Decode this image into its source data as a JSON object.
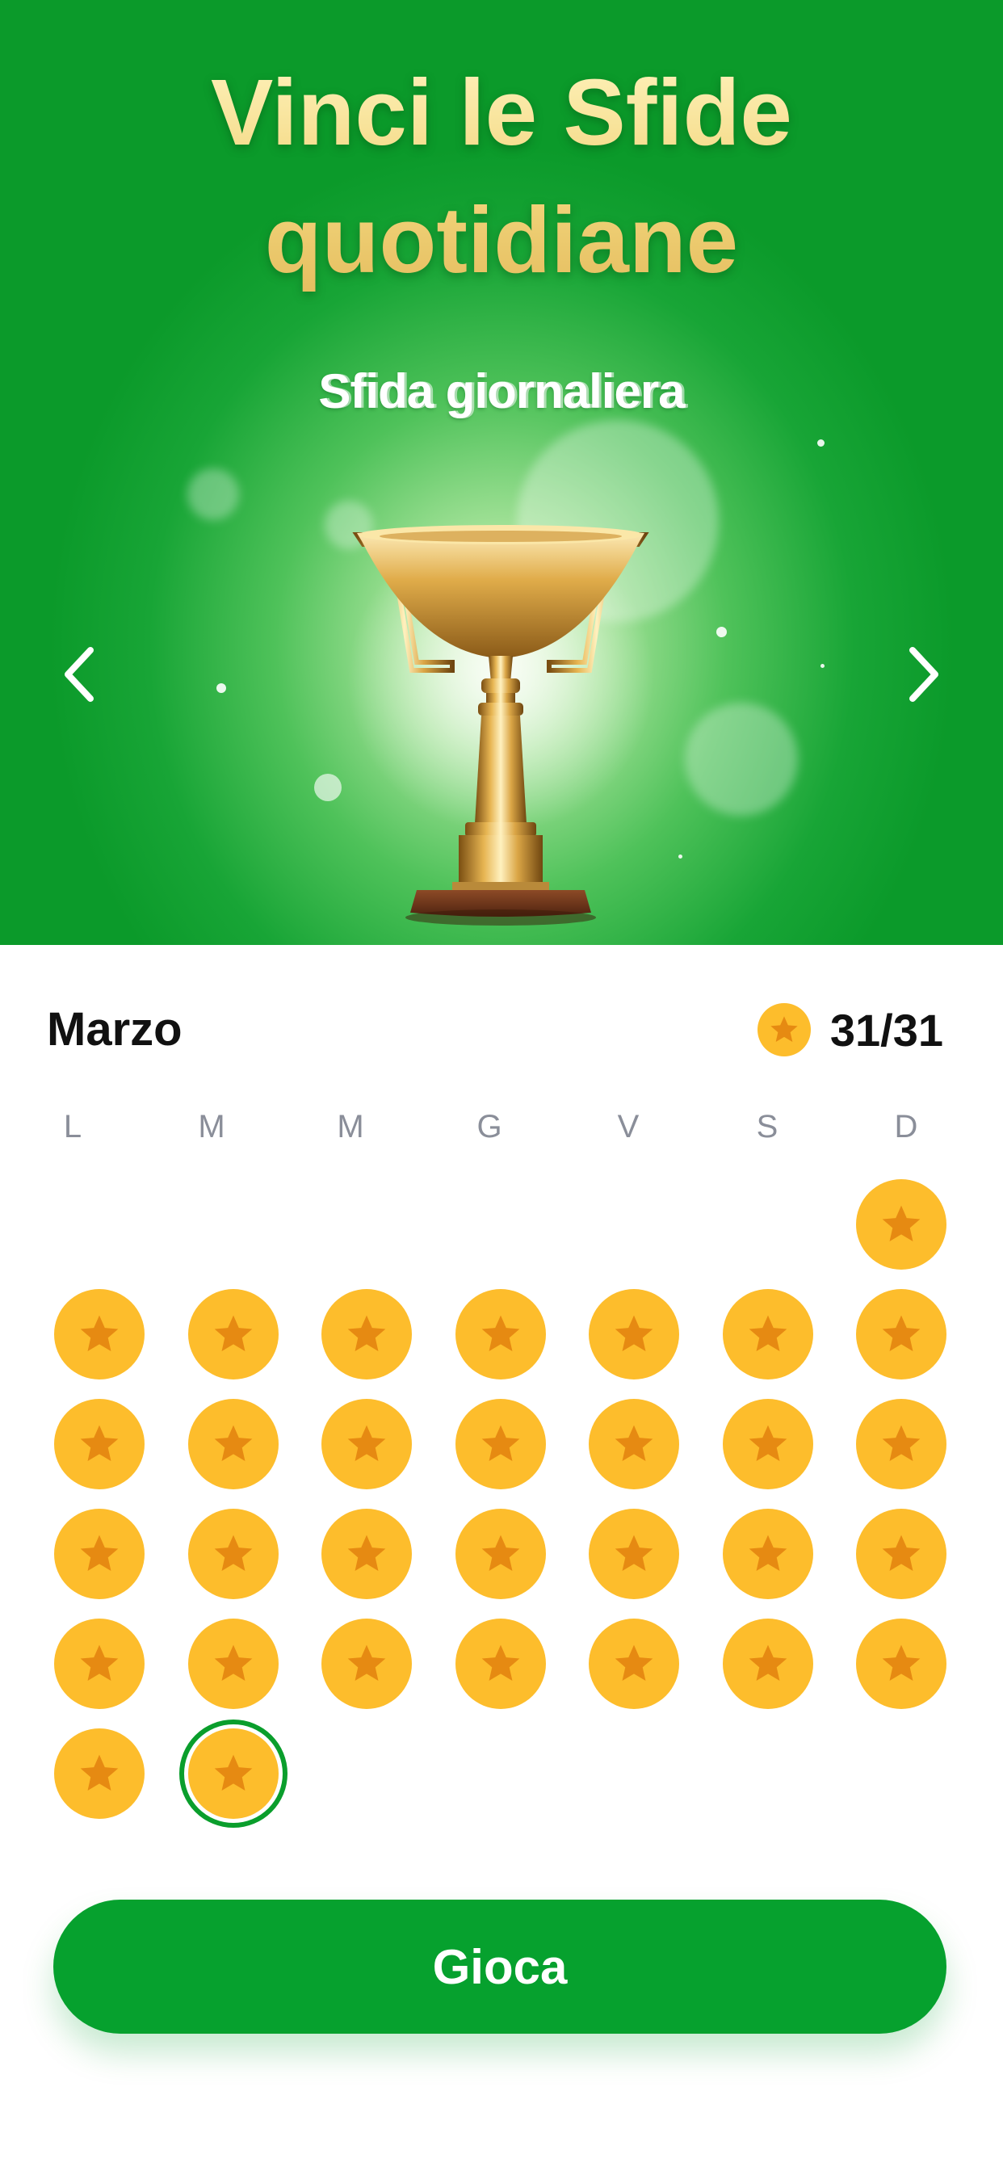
{
  "hero": {
    "title_line1": "Vinci le Sfide",
    "title_line2": "quotidiane",
    "subtitle": "Sfida giornaliera"
  },
  "calendar": {
    "month": "Marzo",
    "progress": "31/31",
    "weekdays": [
      "L",
      "M",
      "M",
      "G",
      "V",
      "S",
      "D"
    ],
    "first_day_column": 7,
    "days_in_month": 31,
    "completed_days": 31,
    "today": 31
  },
  "actions": {
    "play_label": "Gioca"
  },
  "colors": {
    "brand_green": "#06a12e",
    "coin": "#fdbd2c",
    "star": "#e68a12",
    "weekday_text": "#8a8e99"
  },
  "icons": {
    "prev": "chevron-left-icon",
    "next": "chevron-right-icon",
    "coin": "star-coin-icon",
    "trophy": "trophy-icon"
  }
}
